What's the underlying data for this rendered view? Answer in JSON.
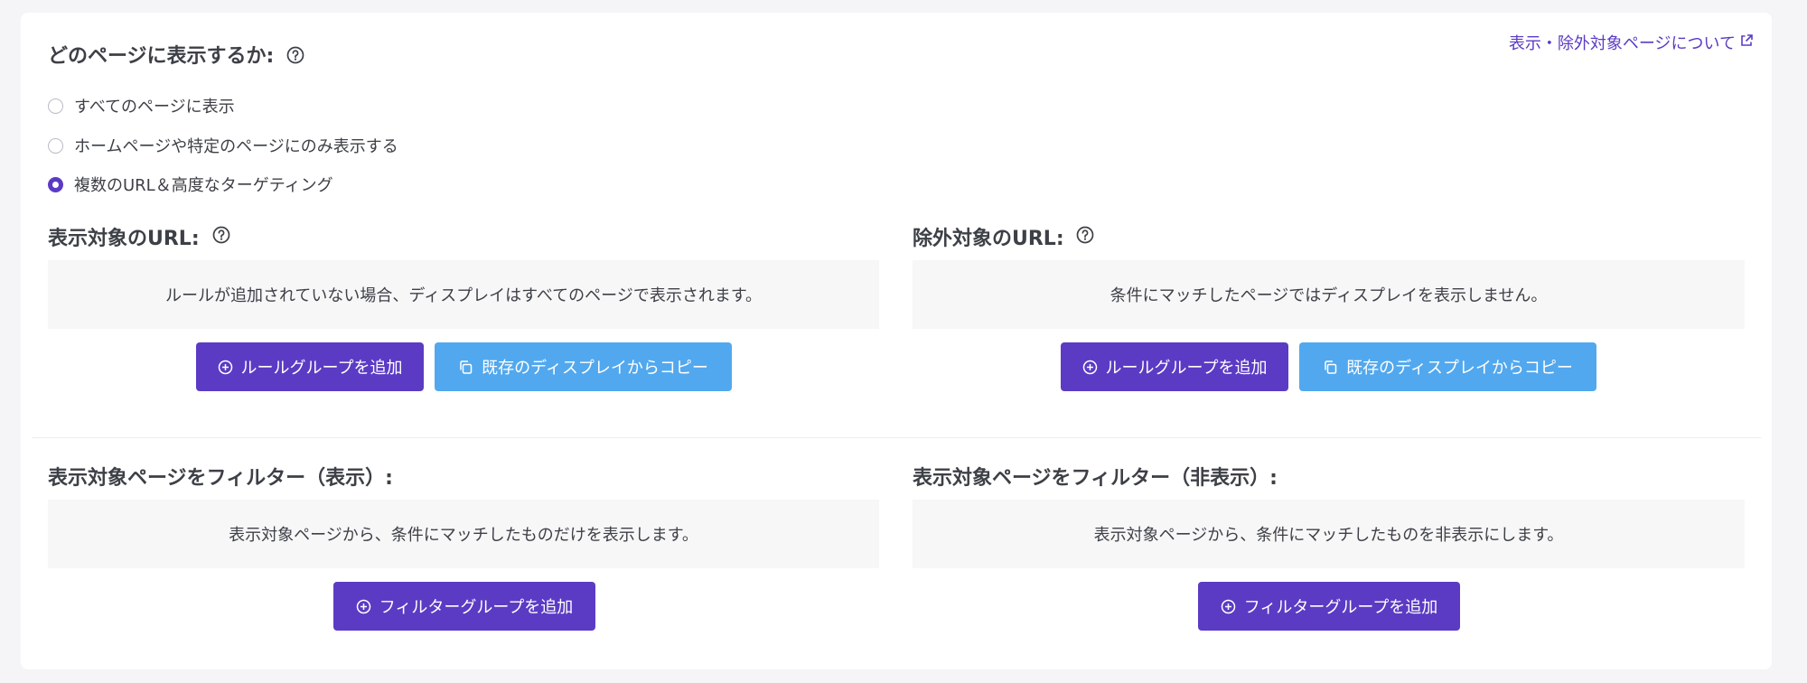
{
  "header": {
    "title": "どのページに表示するか:",
    "link_label": "表示・除外対象ページについて",
    "link_icon": "external-link-icon",
    "help_icon": "question-circle-icon"
  },
  "visibility_options": [
    {
      "label": "すべてのページに表示",
      "checked": false
    },
    {
      "label": "ホームページや特定のページにのみ表示する",
      "checked": false
    },
    {
      "label": "複数のURL＆高度なターゲティング",
      "checked": true
    }
  ],
  "include_urls": {
    "title": "表示対象のURL:",
    "message": "ルールが追加されていない場合、ディスプレイはすべてのページで表示されます。",
    "add_button": "ルールグループを追加",
    "copy_button": "既存のディスプレイからコピー"
  },
  "exclude_urls": {
    "title": "除外対象のURL:",
    "message": "条件にマッチしたページではディスプレイを表示しません。",
    "add_button": "ルールグループを追加",
    "copy_button": "既存のディスプレイからコピー"
  },
  "filter_show": {
    "title": "表示対象ページをフィルター（表示）:",
    "message": "表示対象ページから、条件にマッチしたものだけを表示します。",
    "add_button": "フィルターグループを追加"
  },
  "filter_hide": {
    "title": "表示対象ページをフィルター（非表示）:",
    "message": "表示対象ページから、条件にマッチしたものを非表示にします。",
    "add_button": "フィルターグループを追加"
  },
  "colors": {
    "primary": "#5b3bc4",
    "secondary": "#52a8ee",
    "text": "#3d4046",
    "panel": "#f7f7f8",
    "page_bg": "#f5f5f8"
  }
}
